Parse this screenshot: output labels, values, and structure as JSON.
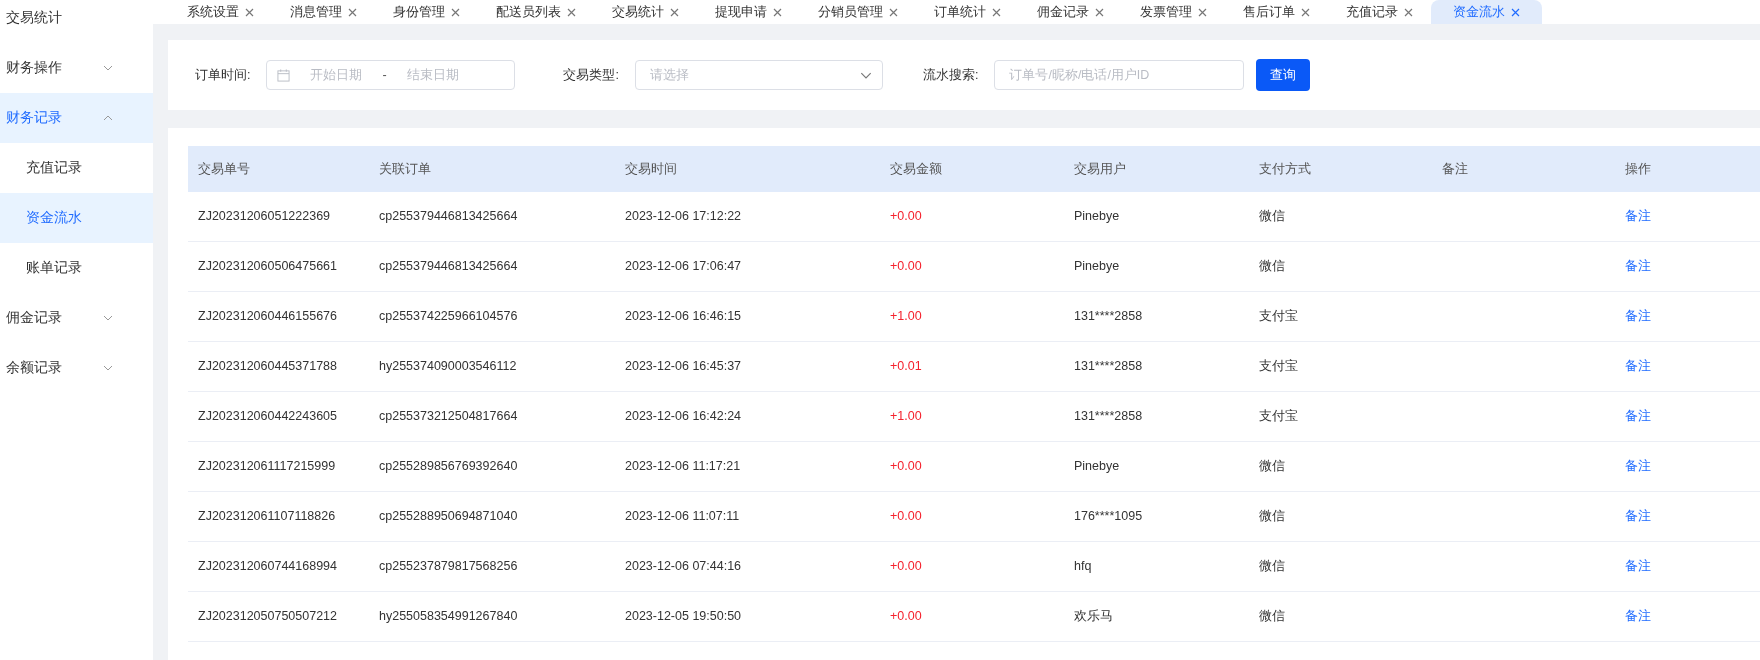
{
  "sidebar": {
    "items": [
      {
        "label": "交易统计",
        "selected": false
      },
      {
        "label": "财务操作",
        "selected": false,
        "expanded": false
      },
      {
        "label": "财务记录",
        "selected": true,
        "expanded": true,
        "children": [
          {
            "label": "充值记录",
            "selected": false
          },
          {
            "label": "资金流水",
            "selected": true
          },
          {
            "label": "账单记录",
            "selected": false
          }
        ]
      },
      {
        "label": "佣金记录",
        "selected": false,
        "expanded": false
      },
      {
        "label": "余额记录",
        "selected": false,
        "expanded": false
      }
    ]
  },
  "tabs": [
    {
      "label": "系统设置",
      "selected": false
    },
    {
      "label": "消息管理",
      "selected": false
    },
    {
      "label": "身份管理",
      "selected": false
    },
    {
      "label": "配送员列表",
      "selected": false
    },
    {
      "label": "交易统计",
      "selected": false
    },
    {
      "label": "提现申请",
      "selected": false
    },
    {
      "label": "分销员管理",
      "selected": false
    },
    {
      "label": "订单统计",
      "selected": false
    },
    {
      "label": "佣金记录",
      "selected": false
    },
    {
      "label": "发票管理",
      "selected": false
    },
    {
      "label": "售后订单",
      "selected": false
    },
    {
      "label": "充值记录",
      "selected": false
    },
    {
      "label": "资金流水",
      "selected": true
    }
  ],
  "filters": {
    "order_time": {
      "label": "订单时间:",
      "start_placeholder": "开始日期",
      "separator": "-",
      "end_placeholder": "结束日期"
    },
    "type": {
      "label": "交易类型:",
      "placeholder": "请选择"
    },
    "search": {
      "label": "流水搜索:",
      "placeholder": "订单号/昵称/电话/用户ID"
    },
    "button": "查询"
  },
  "table": {
    "columns": [
      "交易单号",
      "关联订单",
      "交易时间",
      "交易金额",
      "交易用户",
      "支付方式",
      "备注",
      "操作"
    ],
    "rows": [
      {
        "id": "ZJ20231206051222369",
        "order": "cp255379446813425664",
        "time": "2023-12-06 17:12:22",
        "amount": "+0.00",
        "user": "Pinebye",
        "pay": "微信",
        "action": "备注"
      },
      {
        "id": "ZJ202312060506475661",
        "order": "cp255379446813425664",
        "time": "2023-12-06 17:06:47",
        "amount": "+0.00",
        "user": "Pinebye",
        "pay": "微信",
        "action": "备注"
      },
      {
        "id": "ZJ202312060446155676",
        "order": "cp255374225966104576",
        "time": "2023-12-06 16:46:15",
        "amount": "+1.00",
        "user": "131****2858",
        "pay": "支付宝",
        "action": "备注"
      },
      {
        "id": "ZJ202312060445371788",
        "order": "hy255374090003546112",
        "time": "2023-12-06 16:45:37",
        "amount": "+0.01",
        "user": "131****2858",
        "pay": "支付宝",
        "action": "备注"
      },
      {
        "id": "ZJ202312060442243605",
        "order": "cp255373212504817664",
        "time": "2023-12-06 16:42:24",
        "amount": "+1.00",
        "user": "131****2858",
        "pay": "支付宝",
        "action": "备注"
      },
      {
        "id": "ZJ202312061117215999",
        "order": "cp255289856769392640",
        "time": "2023-12-06 11:17:21",
        "amount": "+0.00",
        "user": "Pinebye",
        "pay": "微信",
        "action": "备注"
      },
      {
        "id": "ZJ202312061107118826",
        "order": "cp255288950694871040",
        "time": "2023-12-06 11:07:11",
        "amount": "+0.00",
        "user": "176****1095",
        "pay": "微信",
        "action": "备注"
      },
      {
        "id": "ZJ202312060744168994",
        "order": "cp255237879817568256",
        "time": "2023-12-06 07:44:16",
        "amount": "+0.00",
        "user": "hfq",
        "pay": "微信",
        "action": "备注"
      },
      {
        "id": "ZJ202312050750507212",
        "order": "hy255058354991267840",
        "time": "2023-12-05 19:50:50",
        "amount": "+0.00",
        "user": "欢乐马",
        "pay": "微信",
        "action": "备注"
      }
    ]
  }
}
